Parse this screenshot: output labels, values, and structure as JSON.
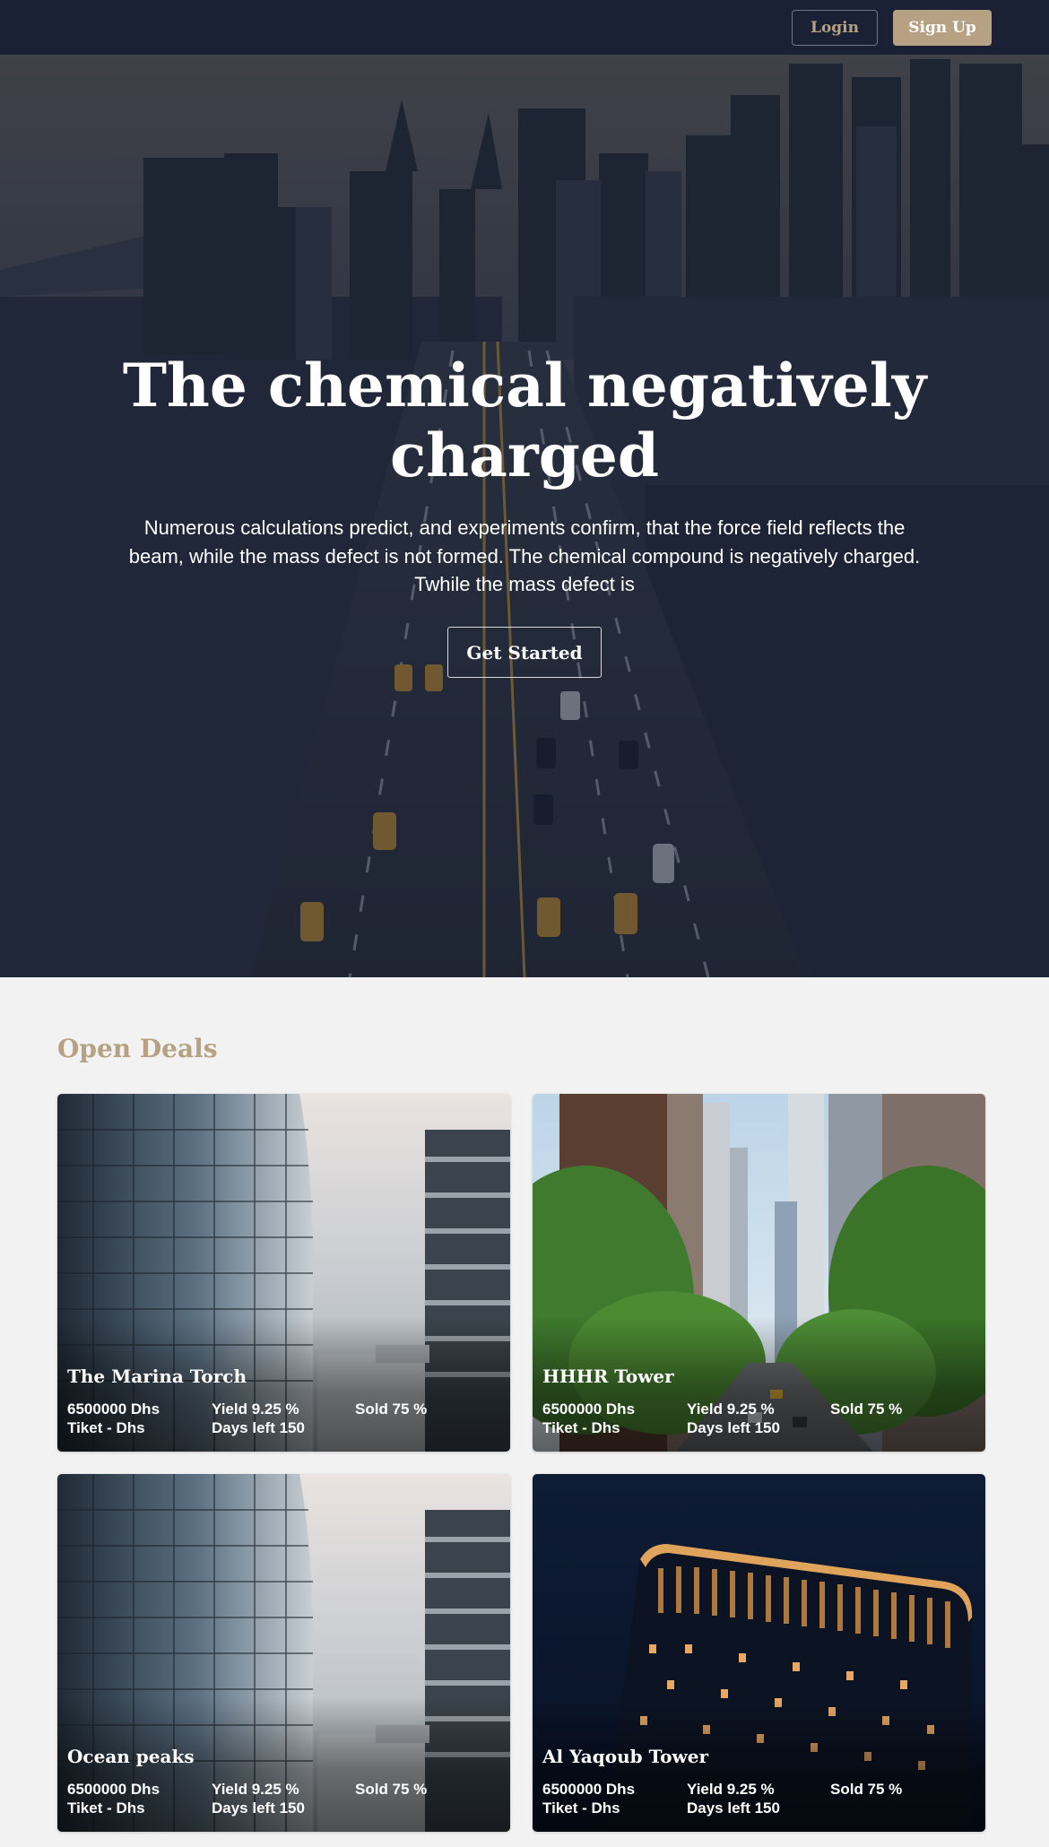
{
  "nav": {
    "login_label": "Login",
    "signup_label": "Sign Up"
  },
  "hero": {
    "title": "The chemical negatively charged",
    "description": "Numerous calculations predict, and experiments confirm, that the force field reflects the beam, while the mass defect is not formed. The chemical compound is negatively charged. Twhile the mass defect is",
    "cta_label": "Get Started"
  },
  "deals": {
    "heading": "Open Deals",
    "items": [
      {
        "title": "The Marina Torch",
        "price": "6500000 Dhs",
        "ticket": "Tiket - Dhs",
        "yield": "Yield 9.25 %",
        "days_left": "Days left 150",
        "sold": "Sold 75 %",
        "image": "glass-skyscraper"
      },
      {
        "title": "HHHR Tower",
        "price": "6500000 Dhs",
        "ticket": "Tiket - Dhs",
        "yield": "Yield 9.25 %",
        "days_left": "Days left 150",
        "sold": "Sold 75 %",
        "image": "tree-lined-street"
      },
      {
        "title": "Ocean peaks",
        "price": "6500000 Dhs",
        "ticket": "Tiket - Dhs",
        "yield": "Yield 9.25 %",
        "days_left": "Days left 150",
        "sold": "Sold 75 %",
        "image": "glass-skyscraper"
      },
      {
        "title": "Al Yaqoub Tower",
        "price": "6500000 Dhs",
        "ticket": "Tiket - Dhs",
        "yield": "Yield 9.25 %",
        "days_left": "Days left 150",
        "sold": "Sold 75 %",
        "image": "lit-building-night"
      }
    ]
  },
  "colors": {
    "navbar": "#1a2135",
    "accent": "#b6a282",
    "page_background": "#f2f2f2",
    "text_light": "#ffffff"
  }
}
